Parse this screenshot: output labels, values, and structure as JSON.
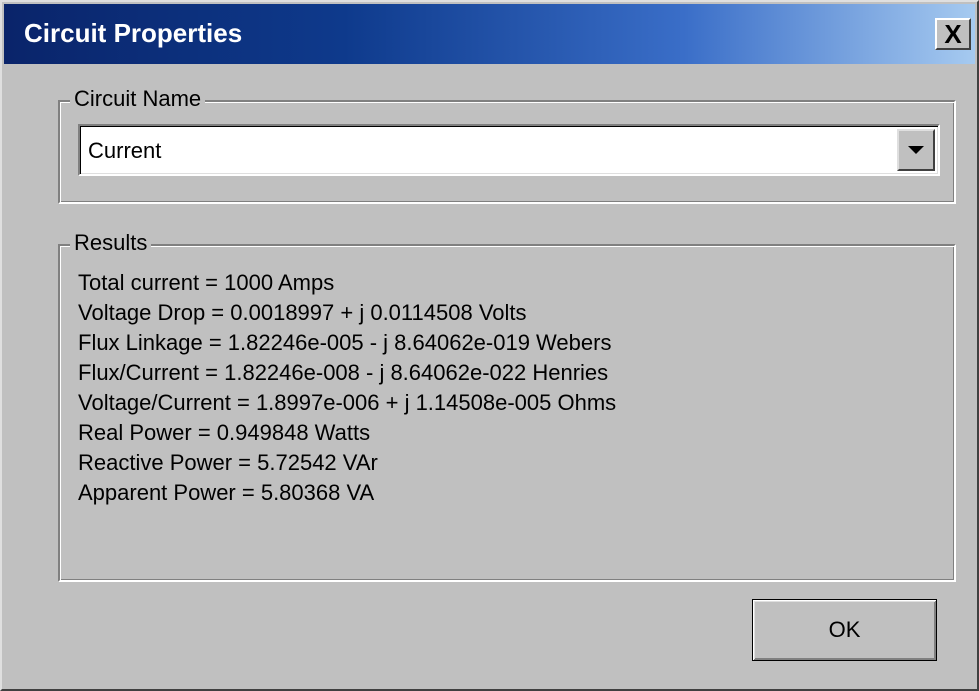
{
  "window": {
    "title": "Circuit Properties",
    "close_label": "X"
  },
  "circuit_name": {
    "legend": "Circuit Name",
    "selected_value": "Current"
  },
  "results": {
    "legend": "Results",
    "lines": [
      "Total current = 1000 Amps",
      "Voltage Drop = 0.0018997 + j 0.0114508 Volts",
      "Flux Linkage = 1.82246e-005 - j 8.64062e-019 Webers",
      "Flux/Current = 1.82246e-008 - j 8.64062e-022 Henries",
      "Voltage/Current = 1.8997e-006 + j 1.14508e-005 Ohms",
      "Real Power = 0.949848 Watts",
      "Reactive Power = 5.72542 VAr",
      "Apparent Power = 5.80368 VA"
    ]
  },
  "buttons": {
    "ok_label": "OK"
  },
  "icons": {
    "close": "close-icon",
    "dropdown": "chevron-down-icon"
  },
  "colors": {
    "titlebar_start": "#0a246a",
    "titlebar_end": "#a6caf0",
    "face": "#c0c0c0"
  }
}
